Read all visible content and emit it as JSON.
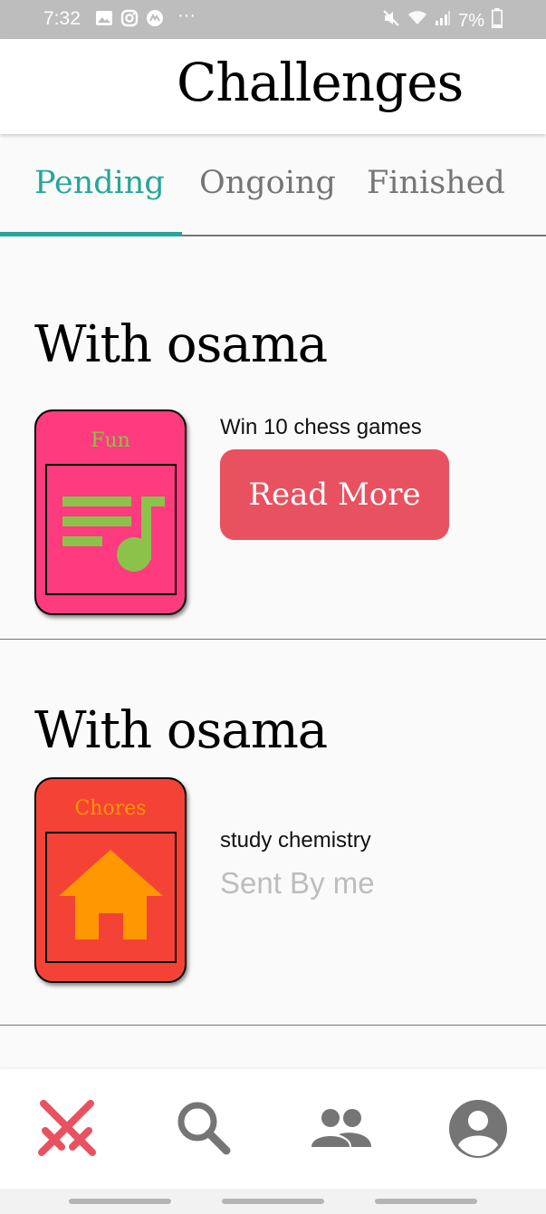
{
  "status_bar": {
    "time": "7:32",
    "left_icons": [
      "gallery-icon",
      "instagram-icon",
      "app-icon",
      "more-icon"
    ],
    "more_dots": "···",
    "right_icons": [
      "mute-icon",
      "wifi-icon",
      "signal-icon",
      "battery-icon"
    ],
    "battery": "7%"
  },
  "app_bar": {
    "title": "Challenges"
  },
  "tabs": [
    {
      "label": "Pending",
      "active": true
    },
    {
      "label": "Ongoing",
      "active": false
    },
    {
      "label": "Finished",
      "active": false
    }
  ],
  "challenges": [
    {
      "heading": "With osama",
      "category": "Fun",
      "category_icon": "music-list-icon",
      "card_color": "#fd3b7e",
      "label_color": "#8bc34a",
      "icon_color": "#8bc34a",
      "description": "Win 10 chess games",
      "action_label": "Read More"
    },
    {
      "heading": "With osama",
      "category": "Chores",
      "category_icon": "home-icon",
      "card_color": "#f44336",
      "label_color": "#ff9800",
      "icon_color": "#ff9800",
      "description": "study chemistry",
      "status": "Sent By me"
    }
  ],
  "bottom_nav": [
    {
      "name": "challenges",
      "icon": "swords-icon",
      "active": true
    },
    {
      "name": "search",
      "icon": "search-icon",
      "active": false
    },
    {
      "name": "friends",
      "icon": "people-icon",
      "active": false
    },
    {
      "name": "profile",
      "icon": "account-icon",
      "active": false
    }
  ],
  "colors": {
    "accent": "#26a69a",
    "active_nav": "#e85260",
    "inactive": "#757575",
    "read_more_button": "#e85260"
  }
}
